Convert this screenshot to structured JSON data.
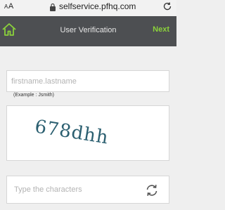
{
  "browser": {
    "aa_label_small": "A",
    "aa_label_large": "A",
    "url": "selfservice.pfhq.com",
    "lock_icon": "lock-icon",
    "reload_icon": "reload-icon"
  },
  "header": {
    "title": "User Verification",
    "next_label": "Next",
    "home_icon": "home-icon",
    "background": "#4d4f52",
    "accent": "#8bd13b"
  },
  "username": {
    "placeholder": "firstname.lastname",
    "value": "",
    "example": "(Example : Jsmith)"
  },
  "captcha": {
    "image_text": "678dhh",
    "text_color": "#2b5f70"
  },
  "captcha_input": {
    "placeholder": "Type the characters",
    "value": "",
    "refresh_icon": "refresh-icon"
  }
}
